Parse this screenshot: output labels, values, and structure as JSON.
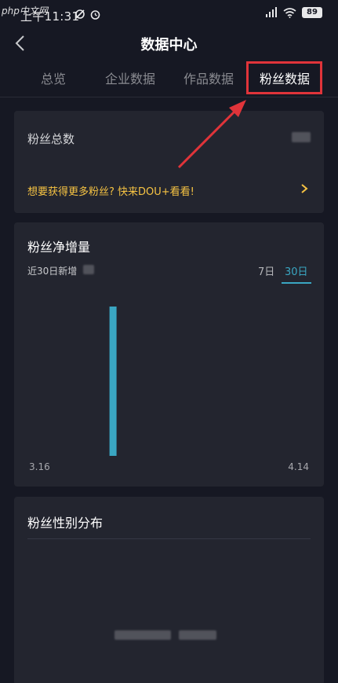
{
  "status_bar": {
    "time": "上午11:31",
    "battery": "89",
    "watermark": "php中文网"
  },
  "header": {
    "title": "数据中心",
    "back_icon": "chevron-left-icon"
  },
  "tabs": [
    {
      "label": "总览",
      "active": false
    },
    {
      "label": "企业数据",
      "active": false
    },
    {
      "label": "作品数据",
      "active": false
    },
    {
      "label": "粉丝数据",
      "active": true
    }
  ],
  "fans_card": {
    "label": "粉丝总数",
    "promo_text": "想要获得更多粉丝? 快来DOU+看看!"
  },
  "growth_card": {
    "title": "粉丝净增量",
    "subtitle": "近30日新增",
    "range_options": [
      "7日",
      "30日"
    ],
    "selected_range": "30日"
  },
  "chart_data": {
    "type": "bar",
    "categories": [
      "3.16",
      "4.14"
    ],
    "x_tick_labels": [
      "3.16",
      "4.14"
    ],
    "bar_position_fraction": 0.3,
    "bar_relative_height": 1.0
  },
  "gender_card": {
    "title": "粉丝性别分布"
  },
  "colors": {
    "background": "#161823",
    "card": "#23252f",
    "accent": "#3aa6c2",
    "promo": "#f6c343",
    "annotation": "#e0343a"
  }
}
